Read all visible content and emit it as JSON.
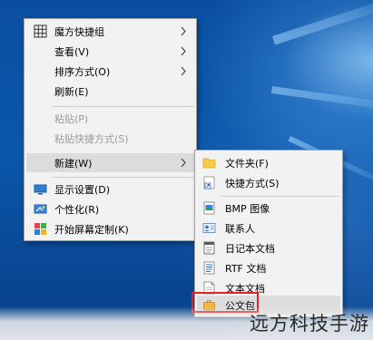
{
  "context_menu": {
    "items": [
      {
        "label": "魔方快捷组",
        "icon": "grid-icon",
        "submenu": true
      },
      {
        "label": "查看(V)",
        "submenu": true
      },
      {
        "label": "排序方式(O)",
        "submenu": true
      },
      {
        "label": "刷新(E)"
      },
      {
        "label": "粘贴(P)",
        "disabled": true
      },
      {
        "label": "粘贴快捷方式(S)",
        "disabled": true
      },
      {
        "label": "新建(W)",
        "submenu": true,
        "highlighted": true
      },
      {
        "label": "显示设置(D)",
        "icon": "display-settings-icon"
      },
      {
        "label": "个性化(R)",
        "icon": "personalize-icon"
      },
      {
        "label": "开始屏幕定制(K)",
        "icon": "start-screen-icon"
      }
    ]
  },
  "new_submenu": {
    "items": [
      {
        "label": "文件夹(F)",
        "icon": "folder-icon"
      },
      {
        "label": "快捷方式(S)",
        "icon": "shortcut-icon"
      },
      {
        "label": "BMP 图像",
        "icon": "bmp-image-icon"
      },
      {
        "label": "联系人",
        "icon": "contact-icon"
      },
      {
        "label": "日记本文档",
        "icon": "journal-document-icon"
      },
      {
        "label": "RTF 文档",
        "icon": "rtf-document-icon"
      },
      {
        "label": "文本文档",
        "icon": "text-document-icon"
      },
      {
        "label": "公文包",
        "icon": "briefcase-icon",
        "highlighted": true
      }
    ]
  },
  "watermark": "远方科技手游",
  "colors": {
    "menu_bg": "#f2f2f2",
    "highlight": "#dcdcdc",
    "disabled_text": "#9a9a9a",
    "annotation_red": "#e0242a",
    "desktop_blue": "#0b57ab"
  }
}
